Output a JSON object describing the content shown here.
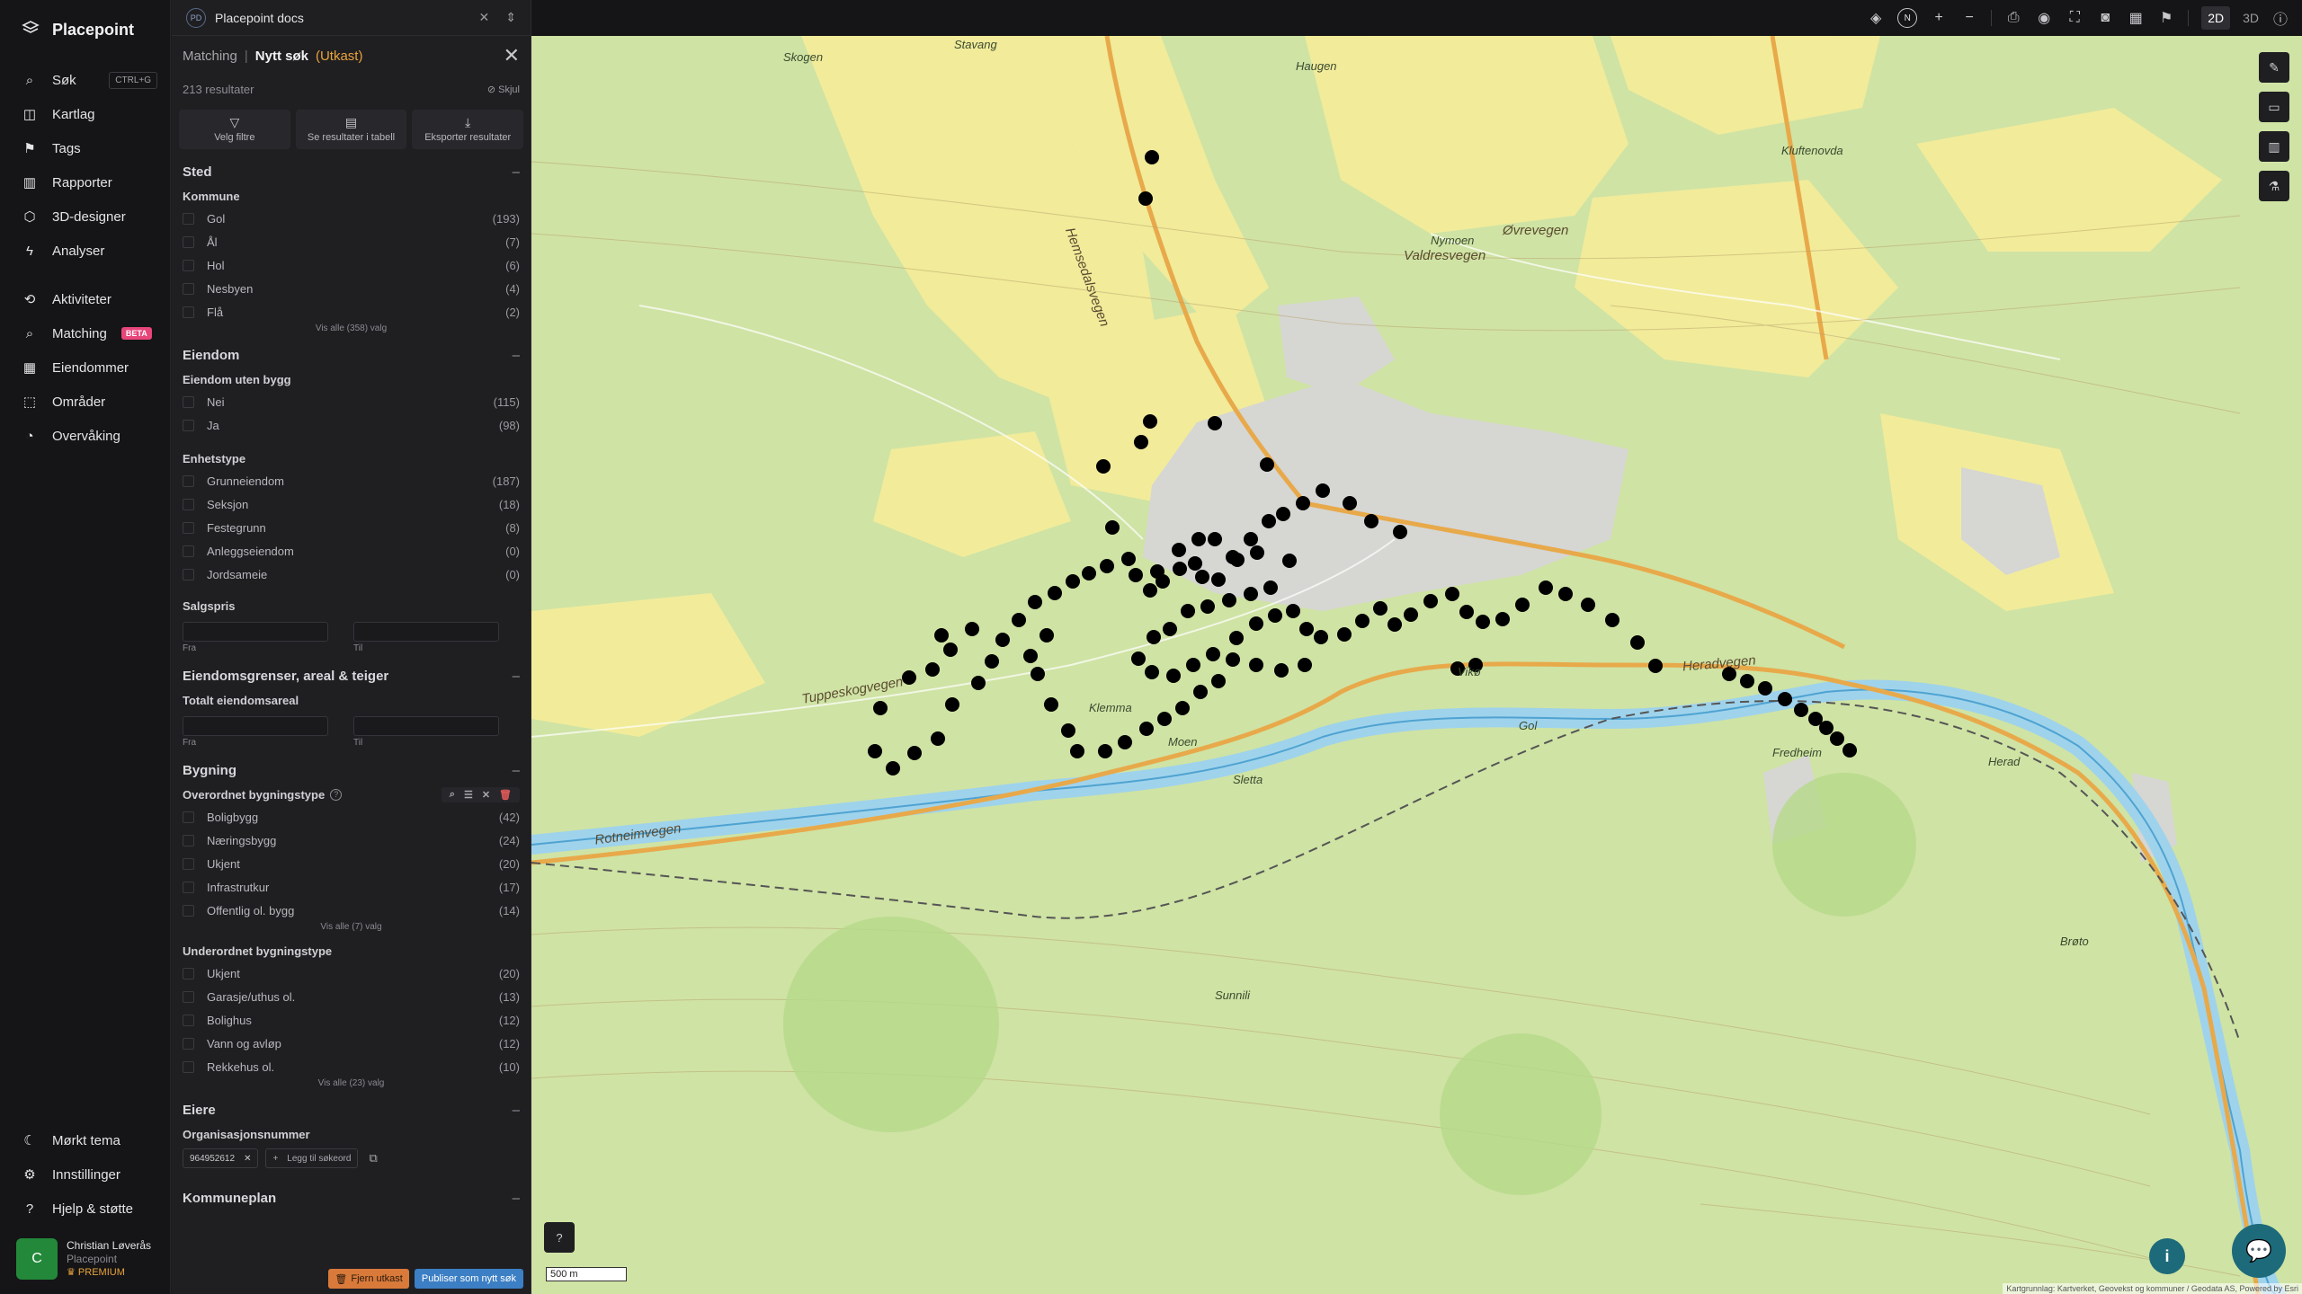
{
  "brand": {
    "name": "Placepoint"
  },
  "nav": {
    "items": [
      {
        "label": "Søk",
        "icon": "search-icon",
        "kbd": "CTRL+G"
      },
      {
        "label": "Kartlag",
        "icon": "layers-icon"
      },
      {
        "label": "Tags",
        "icon": "bookmark-icon"
      },
      {
        "label": "Rapporter",
        "icon": "chart-icon"
      },
      {
        "label": "3D-designer",
        "icon": "cube-icon"
      },
      {
        "label": "Analyser",
        "icon": "bolt-icon"
      },
      {
        "label": "Aktiviteter",
        "icon": "activity-icon"
      },
      {
        "label": "Matching",
        "icon": "search-icon",
        "badge": "BETA"
      },
      {
        "label": "Eiendommer",
        "icon": "building-icon"
      },
      {
        "label": "Områder",
        "icon": "area-icon"
      },
      {
        "label": "Overvåking",
        "icon": "monitor-icon"
      }
    ],
    "bottom": [
      {
        "label": "Mørkt tema",
        "icon": "moon-icon"
      },
      {
        "label": "Innstillinger",
        "icon": "gear-icon"
      },
      {
        "label": "Hjelp & støtte",
        "icon": "help-icon"
      }
    ],
    "user": {
      "initial": "C",
      "name": "Christian Løverås",
      "org": "Placepoint",
      "plan": "PREMIUM"
    }
  },
  "topsearch": {
    "badge": "PD",
    "text": "Placepoint docs"
  },
  "panel": {
    "crumb": "Matching",
    "title": "Nytt søk",
    "draft": "(Utkast)",
    "results": "213 resultater",
    "hide": "Skjul",
    "actions": [
      "Velg filtre",
      "Se resultater i tabell",
      "Eksporter resultater"
    ],
    "sted": {
      "title": "Sted",
      "kommune": "Kommune",
      "options": [
        {
          "label": "Gol",
          "count": "(193)"
        },
        {
          "label": "Ål",
          "count": "(7)"
        },
        {
          "label": "Hol",
          "count": "(6)"
        },
        {
          "label": "Nesbyen",
          "count": "(4)"
        },
        {
          "label": "Flå",
          "count": "(2)"
        }
      ],
      "viewall": "Vis alle (358) valg"
    },
    "eiendom": {
      "title": "Eiendom",
      "sub1": "Eiendom uten bygg",
      "opts1": [
        {
          "label": "Nei",
          "count": "(115)"
        },
        {
          "label": "Ja",
          "count": "(98)"
        }
      ],
      "sub2": "Enhetstype",
      "opts2": [
        {
          "label": "Grunneiendom",
          "count": "(187)"
        },
        {
          "label": "Seksjon",
          "count": "(18)"
        },
        {
          "label": "Festegrunn",
          "count": "(8)"
        },
        {
          "label": "Anleggseiendom",
          "count": "(0)"
        },
        {
          "label": "Jordsameie",
          "count": "(0)"
        }
      ],
      "sub3": "Salgspris",
      "from": "Fra",
      "to": "Til"
    },
    "grenser": {
      "title": "Eiendomsgrenser, areal & teiger",
      "sub": "Totalt eiendomsareal",
      "from": "Fra",
      "to": "Til"
    },
    "bygning": {
      "title": "Bygning",
      "sub1": "Overordnet bygningstype",
      "opts1": [
        {
          "label": "Boligbygg",
          "count": "(42)"
        },
        {
          "label": "Næringsbygg",
          "count": "(24)"
        },
        {
          "label": "Ukjent",
          "count": "(20)"
        },
        {
          "label": "Infrastrutkur",
          "count": "(17)"
        },
        {
          "label": "Offentlig ol. bygg",
          "count": "(14)"
        }
      ],
      "viewall1": "Vis alle (7) valg",
      "sub2": "Underordnet bygningstype",
      "opts2": [
        {
          "label": "Ukjent",
          "count": "(20)"
        },
        {
          "label": "Garasje/uthus ol.",
          "count": "(13)"
        },
        {
          "label": "Bolighus",
          "count": "(12)"
        },
        {
          "label": "Vann og avløp",
          "count": "(12)"
        },
        {
          "label": "Rekkehus ol.",
          "count": "(10)"
        }
      ],
      "viewall2": "Vis alle (23) valg"
    },
    "eiere": {
      "title": "Eiere",
      "sub": "Organisasjonsnummer",
      "chip": "964952612",
      "add": "Legg til søkeord"
    },
    "kommuneplan": {
      "title": "Kommuneplan"
    },
    "footer": {
      "delete": "Fjern utkast",
      "publish": "Publiser som nytt søk"
    }
  },
  "topbar": {
    "north": "N",
    "mode2d": "2D",
    "mode3d": "3D"
  },
  "map": {
    "scale": "500 m",
    "attribution": "Kartgrunnlag: Kartverket, Geovekst og kommuner / Geodata AS, Powered by Esri",
    "labels": [
      "Haugen",
      "Øvrevegen",
      "Valdresvegen",
      "Gol",
      "Moen",
      "Tuppeskogvegen",
      "Rotneimvegen",
      "Heradvegen",
      "Herad",
      "Hemsedalsvegen",
      "Sunnili",
      "Sletta",
      "Fredheim",
      "Brøto",
      "Klemma",
      "Nymoen",
      "Kluftenovda",
      "Vikø",
      "Skogen",
      "Stavang"
    ]
  }
}
